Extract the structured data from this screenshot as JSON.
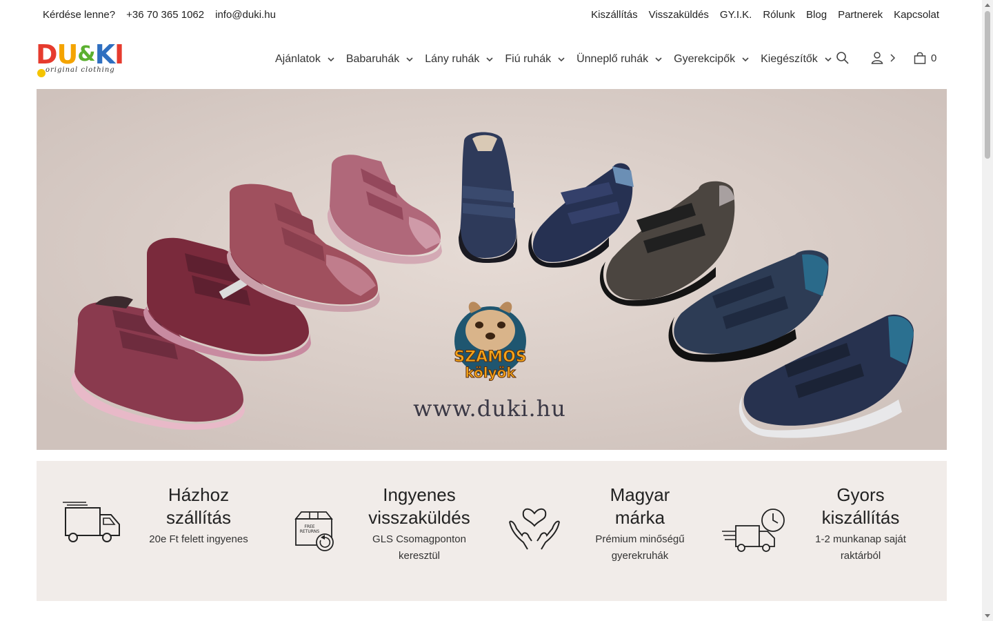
{
  "topbar": {
    "question": "Kérdése lenne?",
    "phone": "+36 70 365 1062",
    "email": "info@duki.hu",
    "links": [
      "Kiszállítás",
      "Visszaküldés",
      "GY.I.K.",
      "Rólunk",
      "Blog",
      "Partnerek",
      "Kapcsolat"
    ]
  },
  "logo": {
    "letters": [
      "D",
      "U",
      "&",
      "K",
      "I"
    ],
    "colors": [
      "#e63b2e",
      "#f4a400",
      "#5bb030",
      "#2f6fc0",
      "#e63b2e"
    ],
    "tagline": "original clothing"
  },
  "nav": {
    "items": [
      "Ajánlatok",
      "Babaruhák",
      "Lány ruhák",
      "Fiú ruhák",
      "Ünneplő ruhák",
      "Gyerekcipők",
      "Kiegészítők"
    ],
    "cart_count": "0"
  },
  "hero": {
    "brand_top": "SZAMOS",
    "brand_bottom": "kölyök",
    "url": "www.duki.hu",
    "background": "#d9cdc7"
  },
  "features": [
    {
      "icon": "truck-icon",
      "title": "Házhoz szállítás",
      "title_lines": [
        "Házhoz",
        "szállítás"
      ],
      "subtitle_lines": [
        "20e Ft felett ingyenes"
      ]
    },
    {
      "icon": "free-returns-box-icon",
      "title_lines": [
        "Ingyenes",
        "visszaküldés"
      ],
      "subtitle_lines": [
        "GLS Csomagponton",
        "keresztül"
      ]
    },
    {
      "icon": "heart-hands-icon",
      "title_lines": [
        "Magyar",
        "márka"
      ],
      "subtitle_lines": [
        "Prémium minőségű",
        "gyerekruhák"
      ]
    },
    {
      "icon": "fast-delivery-icon",
      "title_lines": [
        "Gyors",
        "kiszállítás"
      ],
      "subtitle_lines": [
        "1-2 munkanap saját",
        "raktárból"
      ]
    }
  ],
  "free_returns_label": [
    "FREE",
    "RETURNS"
  ]
}
